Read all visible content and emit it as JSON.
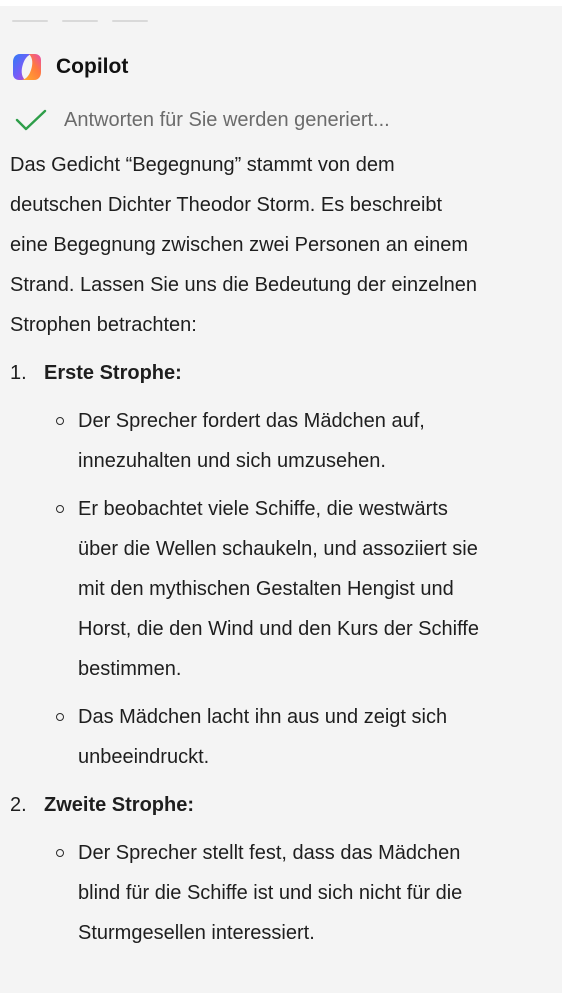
{
  "brand": {
    "name": "Copilot",
    "logo_icon": "copilot-logo-icon"
  },
  "status": {
    "icon": "check-icon",
    "text": "Antworten für Sie werden generiert..."
  },
  "intro": [
    "Das Gedicht “Begegnung” stammt von dem",
    "deutschen Dichter Theodor Storm. Es beschreibt",
    "eine Begegnung zwischen zwei Personen an einem",
    "Strand. Lassen Sie uns die Bedeutung der einzelnen",
    "Strophen betrachten:"
  ],
  "sections": [
    {
      "number": "1.",
      "title": "Erste Strophe:",
      "bullets": [
        [
          "Der Sprecher fordert das Mädchen auf,",
          "innezuhalten und sich umzusehen."
        ],
        [
          "Er beobachtet viele Schiffe, die westwärts",
          "über die Wellen schaukeln, und assoziiert sie",
          "mit den mythischen Gestalten Hengist und",
          "Horst, die den Wind und den Kurs der Schiffe",
          "bestimmen."
        ],
        [
          "Das Mädchen lacht ihn aus und zeigt sich",
          "unbeeindruckt."
        ]
      ]
    },
    {
      "number": "2.",
      "title": "Zweite Strophe:",
      "bullets": [
        [
          "Der Sprecher stellt fest, dass das Mädchen",
          "blind für die Schiffe ist und sich nicht für die",
          "Sturmgesellen interessiert."
        ]
      ]
    }
  ],
  "colors": {
    "panel_bg": "#f4f4f4",
    "check": "#2e9e49",
    "status_text": "#6b6b6b"
  }
}
